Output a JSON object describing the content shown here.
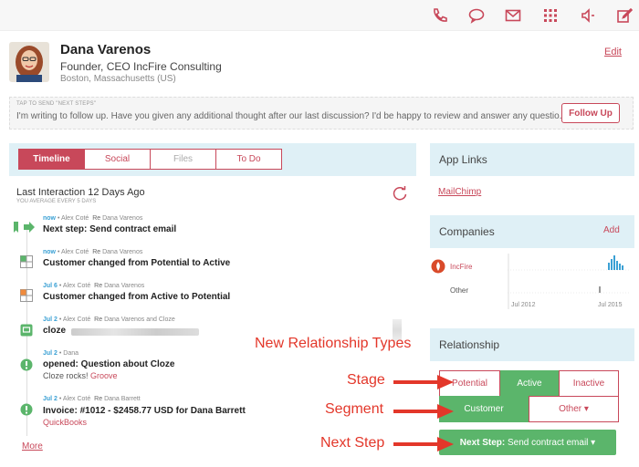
{
  "toolbar": {
    "icons": [
      "phone-icon",
      "chat-icon",
      "mail-icon",
      "grid-icon",
      "speaker-icon",
      "compose-icon"
    ]
  },
  "contact": {
    "name": "Dana Varenos",
    "title": "Founder, CEO IncFire Consulting",
    "location": "Boston, Massachusetts (US)",
    "edit_label": "Edit"
  },
  "tap_send": {
    "label": "TAP TO SEND \"NEXT STEPS\"",
    "message": "I'm writing to follow up. Have you given any additional thought after our last discussion? I'd be happy to review and answer any questio...",
    "button": "Follow Up"
  },
  "tabs": [
    {
      "label": "Timeline",
      "state": "active"
    },
    {
      "label": "Social",
      "state": "normal"
    },
    {
      "label": "Files",
      "state": "disabled"
    },
    {
      "label": "To Do",
      "state": "normal"
    }
  ],
  "timeline": {
    "heading": "Last Interaction 12 Days Ago",
    "subheading": "YOU AVERAGE EVERY 5 DAYS",
    "more_label": "More",
    "items": [
      {
        "when": "now",
        "who": " • Alex Coté",
        "re": "Re",
        "re_target": "Dana Varenos",
        "text": "Next step: Send contract email",
        "sub": "",
        "link": ""
      },
      {
        "when": "now",
        "who": " • Alex Coté",
        "re": "Re",
        "re_target": "Dana Varenos",
        "text": "Customer changed from Potential to Active",
        "sub": "",
        "link": ""
      },
      {
        "when": "Jul 6",
        "who": " • Alex Coté",
        "re": "Re",
        "re_target": "Dana Varenos",
        "text": "Customer changed from Active to Potential",
        "sub": "",
        "link": ""
      },
      {
        "when": "Jul 2",
        "who": " • Alex Coté",
        "re": "Re",
        "re_target": "Dana Varenos and Cloze",
        "text": "cloze",
        "sub": "",
        "link": ""
      },
      {
        "when": "Jul 2",
        "who": " • Dana",
        "re": "",
        "re_target": "",
        "text": "opened: Question about Cloze",
        "sub": "Cloze rocks!",
        "link": "Groove"
      },
      {
        "when": "Jul 2",
        "who": " • Alex Coté",
        "re": "Re",
        "re_target": "Dana Barrett",
        "text": "Invoice: #1012 - $2458.77 USD for Dana Barrett",
        "sub": "",
        "link": "QuickBooks"
      }
    ]
  },
  "app_links": {
    "heading": "App Links",
    "link": "MailChimp"
  },
  "companies": {
    "heading": "Companies",
    "add_label": "Add",
    "rows": [
      {
        "name": "IncFire"
      },
      {
        "name": "Other"
      }
    ],
    "axis_start": "Jul 2012",
    "axis_end": "Jul 2015"
  },
  "relationship": {
    "heading": "Relationship",
    "stage_options": [
      {
        "label": "Potential",
        "selected": false
      },
      {
        "label": "Active",
        "selected": true
      },
      {
        "label": "Inactive",
        "selected": false
      }
    ],
    "segment_options": [
      {
        "label": "Customer",
        "selected": true
      },
      {
        "label": "Other ▾",
        "selected": false
      }
    ],
    "next_step_prefix": "Next Step:",
    "next_step_value": "Send contract email ▾"
  },
  "annotations": {
    "new_types": "New Relationship Types",
    "stage": "Stage",
    "segment": "Segment",
    "next_step": "Next Step"
  },
  "colors": {
    "accent": "#c8485a",
    "panel": "#dff0f6",
    "green": "#5bb56b",
    "link_blue": "#3aa0d4",
    "annotation_red": "#e3372a"
  }
}
